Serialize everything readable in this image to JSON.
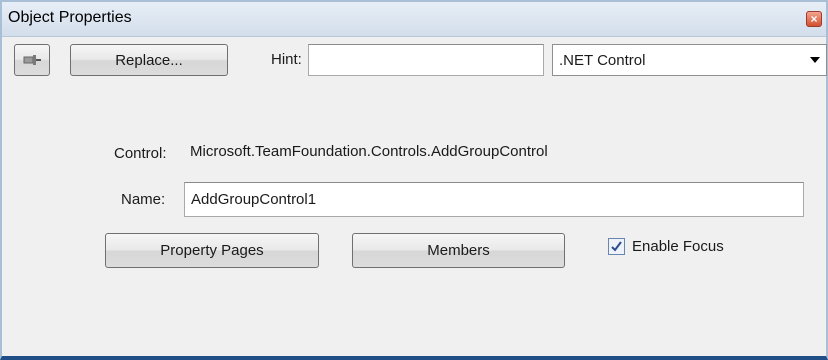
{
  "window": {
    "title": "Object Properties"
  },
  "toolbar": {
    "replace_label": "Replace...",
    "hint_label": "Hint:",
    "hint_value": "",
    "control_type_selected": ".NET Control"
  },
  "properties": {
    "control_label": "Control:",
    "control_value": "Microsoft.TeamFoundation.Controls.AddGroupControl",
    "name_label": "Name:",
    "name_value": "AddGroupControl1",
    "property_pages_label": "Property Pages",
    "members_label": "Members",
    "enable_focus_label": "Enable Focus",
    "enable_focus_checked": true
  },
  "colors": {
    "title_bar": "#dbe5f1",
    "close_button": "#d9593a",
    "window_bottom_border": "#1f4f86",
    "checkbox_check": "#2a4d8f"
  },
  "icons": {
    "pin": "pin-icon",
    "close": "close-icon",
    "dropdown": "chevron-down-icon",
    "check": "check-icon"
  }
}
